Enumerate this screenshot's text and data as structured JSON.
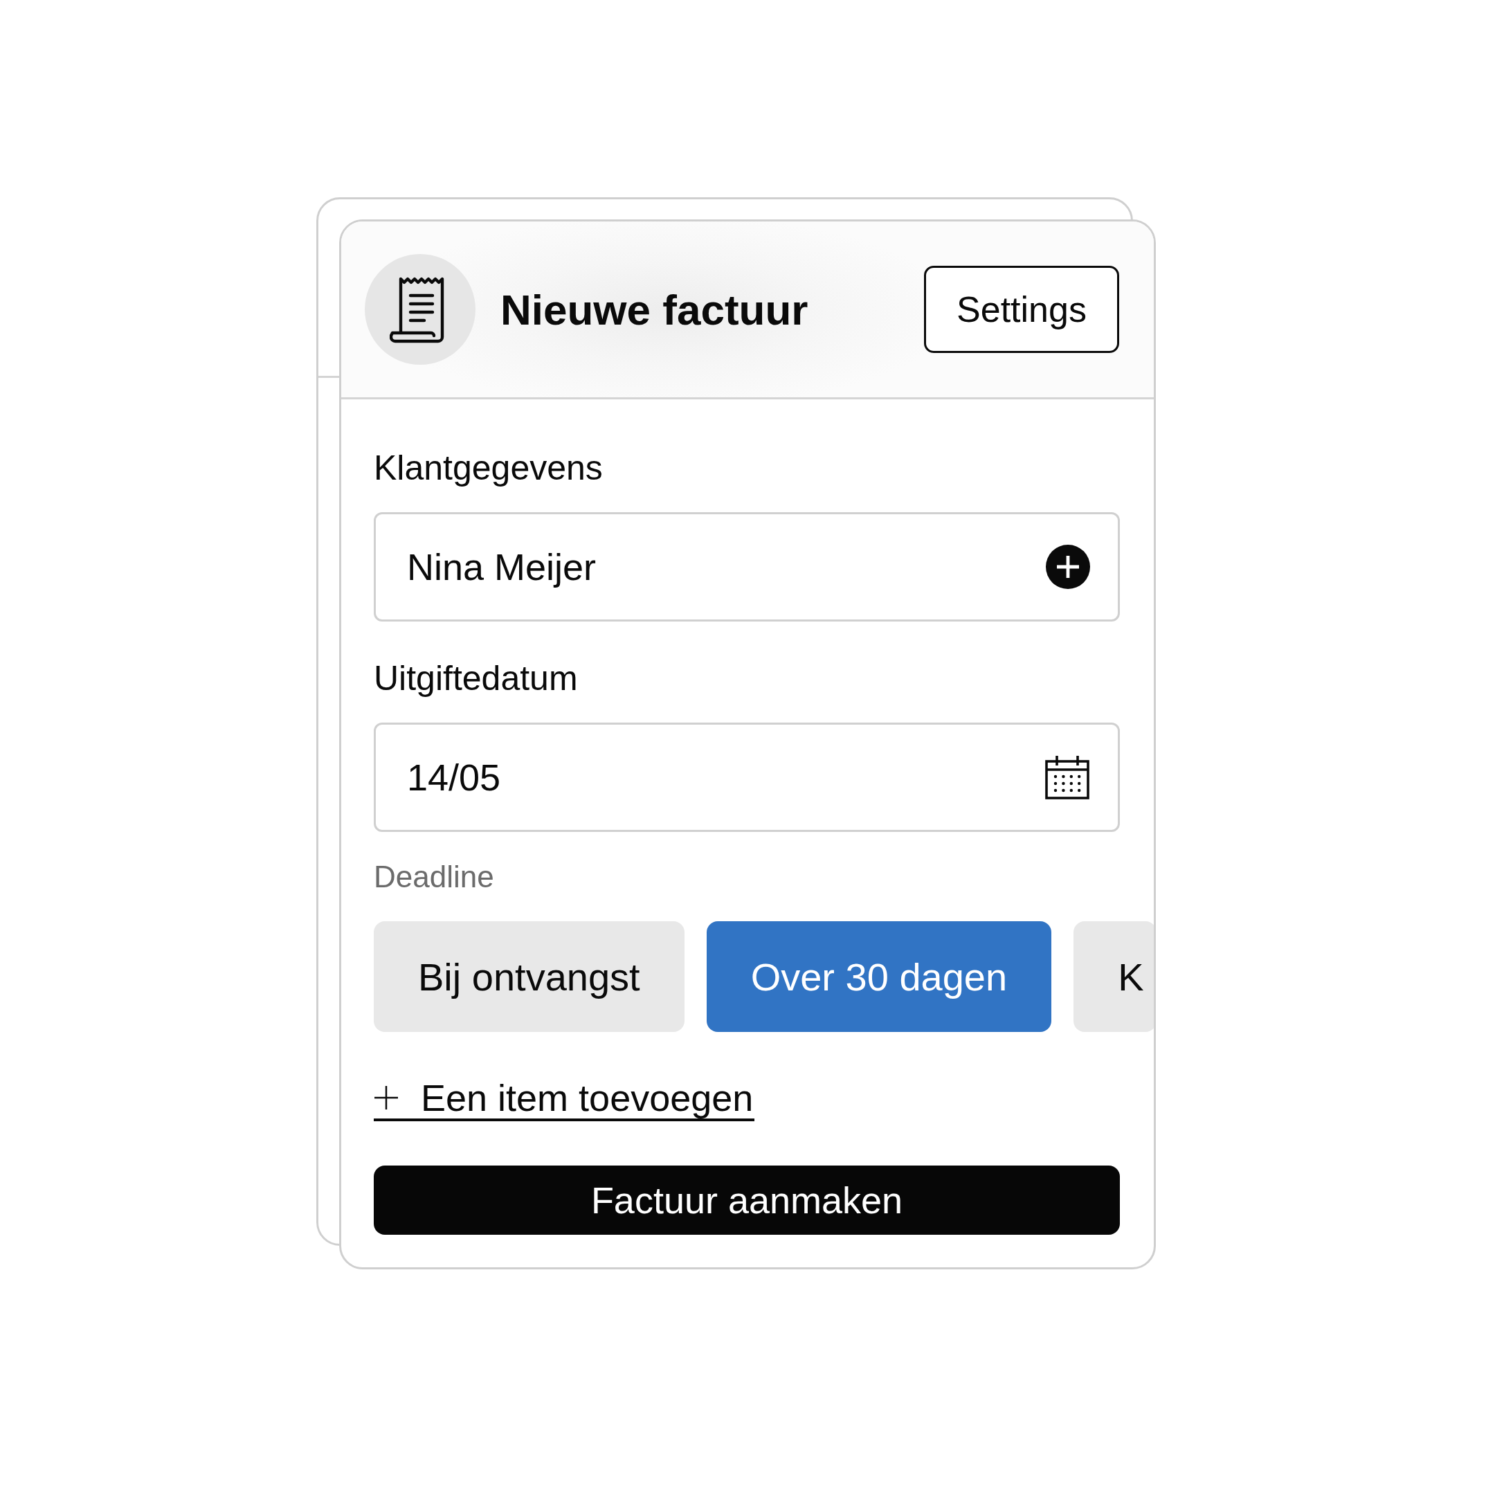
{
  "header": {
    "title": "Nieuwe factuur",
    "settings_button": "Settings"
  },
  "fields": [
    {
      "label": "Klantgegevens",
      "value": "Nina Meijer",
      "kind": "add"
    },
    {
      "label": "Uitgiftedatum",
      "value": "14/05",
      "kind": "date"
    }
  ],
  "deadline": {
    "label": "Deadline",
    "options": [
      {
        "label": "Bij ontvangst",
        "selected": false
      },
      {
        "label": "Over 30 dagen",
        "selected": true
      },
      {
        "label": "K",
        "selected": false
      }
    ]
  },
  "add_item_link": "Een item toevoegen",
  "submit_button": "Factuur aanmaken"
}
